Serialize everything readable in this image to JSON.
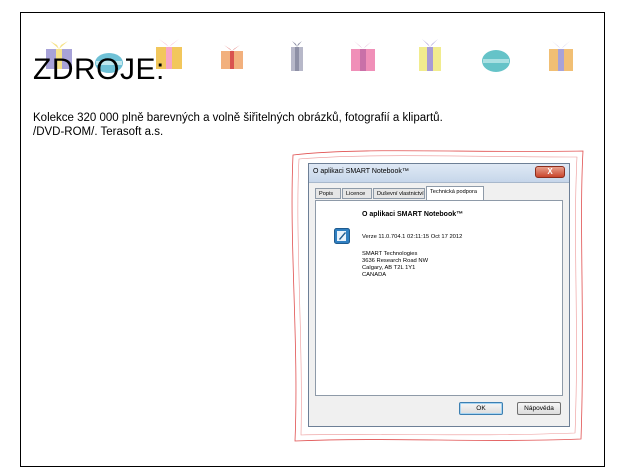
{
  "slide": {
    "title": "ZDROJE:",
    "source_line1": "Kolekce 320 000 plně barevných a volně šiřitelných obrázků, fotografií a klipartů.",
    "source_line2": "/DVD-ROM/. Terasoft a.s."
  },
  "dialog": {
    "title": "O aplikaci SMART Notebook™",
    "close_label": "X",
    "tabs": [
      "Popis",
      "Licence",
      "Duševní vlastnictví",
      "Technická podpora"
    ],
    "active_tab": "Technická podpora",
    "heading": "O aplikaci SMART Notebook™",
    "version": "Verze 11.0.704.1 02:11:15 Oct 17 2012",
    "company_lines": [
      "SMART Technologies",
      "3636 Research Road NW",
      "Calgary, AB T2L 1Y1",
      "CANADA"
    ],
    "ok_label": "OK",
    "help_label": "Nápověda"
  },
  "colors": {
    "gift_colors": [
      "#a7a2d8",
      "#6fc1d6",
      "#f2c75c",
      "#f2b07d",
      "#b7b8c9",
      "#f08fb8",
      "#f1ec8e",
      "#65c3c8",
      "#f1bf74"
    ],
    "frame_line": "#e05050",
    "dialog_border": "#6d7f96",
    "ok_border": "#3c7fb1"
  }
}
